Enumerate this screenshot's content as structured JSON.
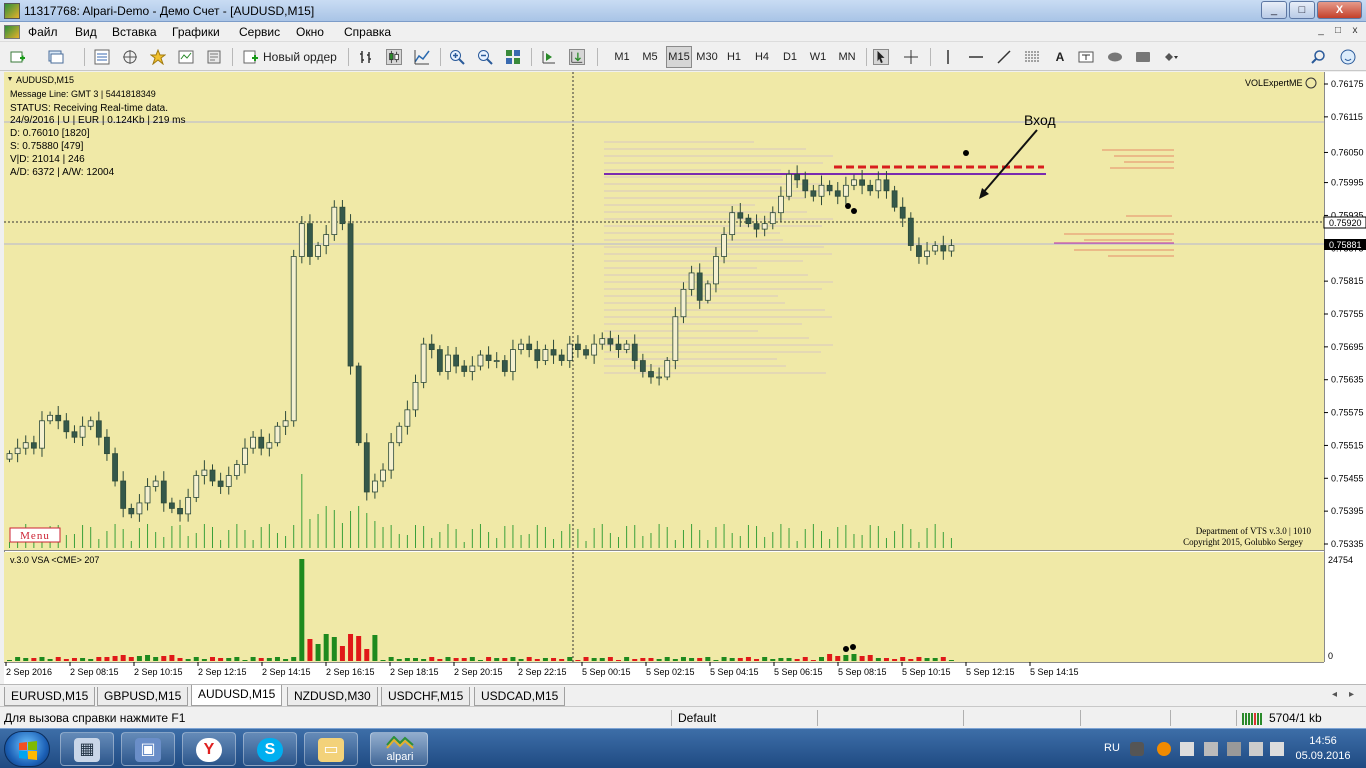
{
  "window": {
    "title": "11317768: Alpari-Demo - Демо Счет - [AUDUSD,M15]",
    "buttons": [
      "_",
      "□",
      "X"
    ]
  },
  "menu": {
    "items": [
      "Файл",
      "Вид",
      "Вставка",
      "Графики",
      "Сервис",
      "Окно",
      "Справка"
    ],
    "mdi_buttons": [
      "_",
      "□",
      "x"
    ]
  },
  "toolbar": {
    "new_order_label": "Новый ордер",
    "timeframes": [
      "M1",
      "M5",
      "M15",
      "M30",
      "H1",
      "H4",
      "D1",
      "W1",
      "MN"
    ],
    "active_timeframe": "M15",
    "draw_text_tool": "A"
  },
  "chart_info": {
    "symbol": "AUDUSD,M15",
    "lines": [
      "Message Line: GMT 3 | 5441818349",
      "STATUS:  Receiving Real-time data.",
      "24/9/2016 | U | EUR | 0.124Kb | 219 ms",
      "D: 0.76010  [1820]",
      "S: 0.75880  [479]",
      "V|D: 21014 | 246",
      "A/D: 6372 | A/W: 12004"
    ],
    "expert": "VOLExpertME",
    "menu_button": "Menu",
    "annotation": "Вход",
    "credit_line1": "Department of VTS  v.3.0 | 1010",
    "credit_line2": "Copyright 2015, Golubko Sergey",
    "indicator_title": "v.3.0 VSA <CME> 207",
    "indicator_max": "24754",
    "indicator_zero": "0",
    "current_price": "0.75881",
    "crosshair_price": "0.75920"
  },
  "chart_data": {
    "type": "candlestick",
    "symbol": "AUDUSD",
    "timeframe": "M15",
    "y_ticks": [
      "0.76175",
      "0.76115",
      "0.76050",
      "0.75995",
      "0.75935",
      "0.75875",
      "0.75815",
      "0.75755",
      "0.75695",
      "0.75635",
      "0.75575",
      "0.75515",
      "0.75455",
      "0.75395",
      "0.75335"
    ],
    "x_labels": [
      "2 Sep 2016",
      "2 Sep 08:15",
      "2 Sep 10:15",
      "2 Sep 12:15",
      "2 Sep 14:15",
      "2 Sep 16:15",
      "2 Sep 18:15",
      "2 Sep 20:15",
      "2 Sep 22:15",
      "5 Sep 00:15",
      "5 Sep 02:15",
      "5 Sep 04:15",
      "5 Sep 06:15",
      "5 Sep 08:15",
      "5 Sep 10:15",
      "5 Sep 12:15",
      "5 Sep 14:15"
    ],
    "ylim": [
      0.75335,
      0.76175
    ],
    "candles_close": [
      0.755,
      0.7551,
      0.7552,
      0.7551,
      0.7556,
      0.7557,
      0.7556,
      0.7554,
      0.7553,
      0.7555,
      0.7556,
      0.7553,
      0.755,
      0.7545,
      0.754,
      0.7539,
      0.7541,
      0.7544,
      0.7545,
      0.7541,
      0.754,
      0.7539,
      0.7542,
      0.7546,
      0.7547,
      0.7545,
      0.7544,
      0.7546,
      0.7548,
      0.7551,
      0.7553,
      0.7551,
      0.7552,
      0.7555,
      0.7556,
      0.7586,
      0.7592,
      0.7586,
      0.7588,
      0.759,
      0.7595,
      0.7592,
      0.7566,
      0.7552,
      0.7543,
      0.7545,
      0.7547,
      0.7552,
      0.7555,
      0.7558,
      0.7563,
      0.757,
      0.7569,
      0.7565,
      0.7568,
      0.7566,
      0.7565,
      0.7566,
      0.7568,
      0.7567,
      0.7567,
      0.7565,
      0.7569,
      0.757,
      0.7569,
      0.7567,
      0.7569,
      0.7568,
      0.7567,
      0.757,
      0.7569,
      0.7568,
      0.757,
      0.7571,
      0.757,
      0.7569,
      0.757,
      0.7567,
      0.7565,
      0.7564,
      0.7564,
      0.7567,
      0.7575,
      0.758,
      0.7583,
      0.7578,
      0.7581,
      0.7586,
      0.759,
      0.7594,
      0.7593,
      0.7592,
      0.7591,
      0.7592,
      0.7594,
      0.7597,
      0.7601,
      0.76,
      0.7598,
      0.7597,
      0.7599,
      0.7598,
      0.7597,
      0.7599,
      0.76,
      0.7599,
      0.7598,
      0.76,
      0.7598,
      0.7595,
      0.7593,
      0.7588,
      0.7586,
      0.7587,
      0.7588,
      0.7587,
      0.7588
    ],
    "volume_max": 24754,
    "annotations": [
      "Вход"
    ]
  }
}
